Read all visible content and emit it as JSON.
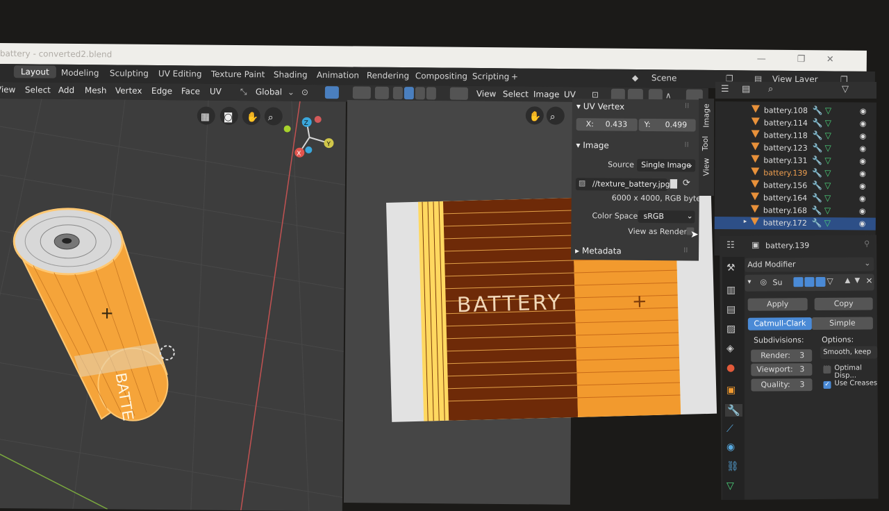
{
  "window": {
    "title": "battery - converted2.blend",
    "controls": [
      "—",
      "❐",
      "✕"
    ]
  },
  "workspaces": {
    "tabs": [
      "Layout",
      "Modeling",
      "Sculpting",
      "UV Editing",
      "Texture Paint",
      "Shading",
      "Animation",
      "Rendering",
      "Compositing",
      "Scripting",
      "+"
    ],
    "active": "Layout",
    "scene_label": "Scene",
    "view_layer_label": "View Layer"
  },
  "viewport_menu": [
    "View",
    "Select",
    "Add",
    "Mesh",
    "Vertex",
    "Edge",
    "Face",
    "UV"
  ],
  "transform_orientation": "Global",
  "uv_menu": [
    "View",
    "Select",
    "Image",
    "UV"
  ],
  "gizmo": {
    "z": "Z",
    "y": "Y",
    "x": "X"
  },
  "uv_vertex": {
    "header": "UV Vertex",
    "x_label": "X:",
    "x_value": "0.433",
    "y_label": "Y:",
    "y_value": "0.499"
  },
  "image_panel": {
    "header": "Image",
    "source_label": "Source",
    "source_value": "Single Image",
    "file_path": "//texture_battery.jpg",
    "info": "6000 x 4000,  RGB byte",
    "color_space_label": "Color Space",
    "color_space_value": "sRGB",
    "view_as_render_label": "View as Render",
    "metadata_label": "Metadata"
  },
  "sidebar_tabs": [
    "Image",
    "Tool",
    "View"
  ],
  "texture_text": "BATTERY",
  "outliner": {
    "items": [
      {
        "name": "battery.108",
        "selected": false,
        "active": false
      },
      {
        "name": "battery.114",
        "selected": false,
        "active": false
      },
      {
        "name": "battery.118",
        "selected": false,
        "active": false
      },
      {
        "name": "battery.123",
        "selected": false,
        "active": false
      },
      {
        "name": "battery.131",
        "selected": false,
        "active": false
      },
      {
        "name": "battery.139",
        "selected": false,
        "active": true
      },
      {
        "name": "battery.156",
        "selected": false,
        "active": false
      },
      {
        "name": "battery.164",
        "selected": false,
        "active": false
      },
      {
        "name": "battery.168",
        "selected": false,
        "active": false
      },
      {
        "name": "battery.172",
        "selected": true,
        "active": false
      }
    ]
  },
  "properties": {
    "object_name": "battery.139",
    "add_modifier_label": "Add Modifier",
    "modifier_short": "Su",
    "apply_label": "Apply",
    "copy_label": "Copy",
    "catmull_label": "Catmull-Clark",
    "simple_label": "Simple",
    "subdivisions_label": "Subdivisions:",
    "options_label": "Options:",
    "render_label": "Render:",
    "render_value": "3",
    "viewport_label": "Viewport:",
    "viewport_value": "3",
    "quality_label": "Quality:",
    "quality_value": "3",
    "smooth_label": "Smooth, keep ...",
    "optimal_label": "Optimal Disp...",
    "optimal_checked": false,
    "creases_label": "Use Creases",
    "creases_checked": true
  },
  "colors": {
    "accent_blue": "#4a8ad6",
    "selection_orange": "#f5a43a",
    "outliner_active": "#e8913a",
    "mesh_green": "#4cd37b"
  }
}
